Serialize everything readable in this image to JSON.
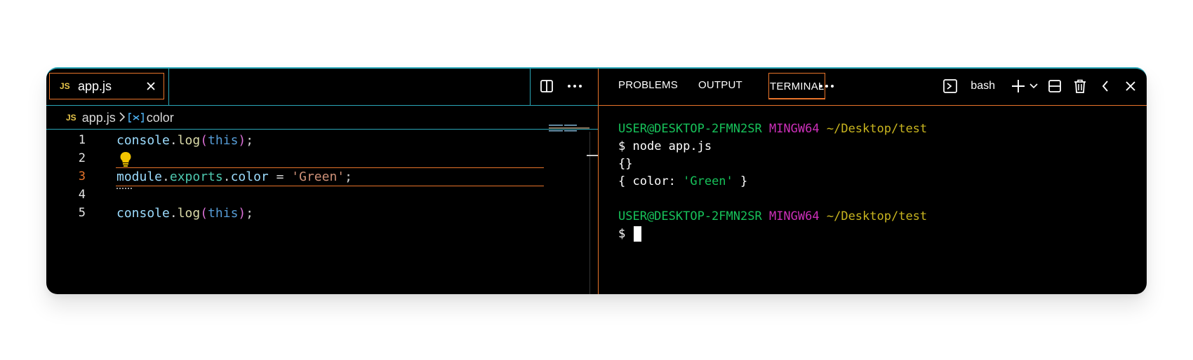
{
  "editor": {
    "tab": {
      "badge": "JS",
      "filename": "app.js"
    },
    "breadcrumb": {
      "badge": "JS",
      "file": "app.js",
      "symbol": "color"
    },
    "lines": [
      {
        "number": "1",
        "active": false
      },
      {
        "number": "2",
        "active": false
      },
      {
        "number": "3",
        "active": true
      },
      {
        "number": "4",
        "active": false
      },
      {
        "number": "5",
        "active": false
      }
    ],
    "code": {
      "line1": {
        "obj": "console",
        "dot": ".",
        "fn": "log",
        "open": "(",
        "arg": "this",
        "close": ")",
        "semi": ";"
      },
      "line3": {
        "a": "module",
        "dot1": ".",
        "b": "exports",
        "dot2": ".",
        "c": "color",
        "eq": " = ",
        "str": "'Green'",
        "semi": ";"
      },
      "line5": {
        "obj": "console",
        "dot": ".",
        "fn": "log",
        "open": "(",
        "arg": "this",
        "close": ")",
        "semi": ";"
      }
    },
    "icons": [
      "split-editor-icon",
      "more-actions-icon",
      "close-icon",
      "lightbulb-icon",
      "symbol-variable-icon",
      "chevron-right-icon"
    ]
  },
  "panel": {
    "tabs": [
      "PROBLEMS",
      "OUTPUT",
      "TERMINAL"
    ],
    "active_tab": "TERMINAL",
    "more": "⋯",
    "shell": "bash",
    "terminal": [
      {
        "user": "USER@DESKTOP-2FMN2SR",
        "host": "MINGW64",
        "path": "~/Desktop/test"
      },
      {
        "prompt": "$ ",
        "cmd": "node app.js"
      },
      {
        "out": "{}"
      },
      {
        "out_a": "{ color: ",
        "out_str": "'Green'",
        "out_b": " }"
      },
      {
        "blank": ""
      },
      {
        "user": "USER@DESKTOP-2FMN2SR",
        "host": "MINGW64",
        "path": "~/Desktop/test"
      },
      {
        "prompt": "$ "
      }
    ]
  },
  "colors": {
    "accent": "#e8742a",
    "border": "#2aa7b8",
    "background": "#000000",
    "user": "#17c25a",
    "host": "#cc2fb9",
    "path": "#c9b51f"
  }
}
